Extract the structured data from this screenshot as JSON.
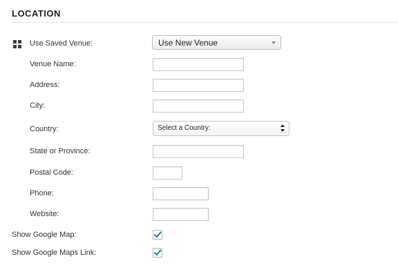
{
  "section": {
    "title": "LOCATION"
  },
  "venue": {
    "label": "Use Saved Venue:",
    "icon": "grid-icon",
    "selected": "Use New Venue"
  },
  "fields": {
    "venue_name": {
      "label": "Venue Name:",
      "value": ""
    },
    "address": {
      "label": "Address:",
      "value": ""
    },
    "city": {
      "label": "City:",
      "value": ""
    },
    "country": {
      "label": "Country:",
      "selected": "Select a Country:"
    },
    "state": {
      "label": "State or Province:",
      "value": ""
    },
    "postal_code": {
      "label": "Postal Code:",
      "value": ""
    },
    "phone": {
      "label": "Phone:",
      "value": ""
    },
    "website": {
      "label": "Website:",
      "value": ""
    }
  },
  "map": {
    "show_map_label": "Show Google Map:",
    "show_map_checked": true,
    "show_link_label": "Show Google Maps Link:",
    "show_link_checked": true
  },
  "colors": {
    "checkmark": "#1e8cbe"
  }
}
